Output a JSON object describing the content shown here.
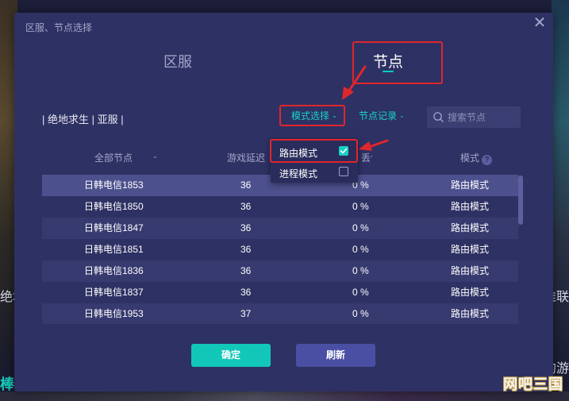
{
  "background": {
    "left_text": "绝地求",
    "right_text": "准联",
    "left_bottom_text": "棒",
    "right_bottom_text": "的游"
  },
  "dialog": {
    "title": "区服、节点选择",
    "close_symbol": "✕",
    "tabs": [
      {
        "label": "区服",
        "active": false
      },
      {
        "label": "节点",
        "active": true
      }
    ]
  },
  "toolbar": {
    "game_label": "| 绝地求生 | 亚服 |",
    "mode_select_label": "模式选择",
    "history_label": "节点记录",
    "search_placeholder": "搜索节点"
  },
  "table": {
    "headers": {
      "node": "全部节点",
      "latency": "游戏延迟",
      "loss": "丢包",
      "mode": "模式"
    },
    "rows": [
      {
        "node": "日韩电信1853",
        "latency": "36",
        "loss": "0 %",
        "mode": "路由模式"
      },
      {
        "node": "日韩电信1850",
        "latency": "36",
        "loss": "0 %",
        "mode": "路由模式"
      },
      {
        "node": "日韩电信1847",
        "latency": "36",
        "loss": "0 %",
        "mode": "路由模式"
      },
      {
        "node": "日韩电信1851",
        "latency": "36",
        "loss": "0 %",
        "mode": "路由模式"
      },
      {
        "node": "日韩电信1836",
        "latency": "36",
        "loss": "0 %",
        "mode": "路由模式"
      },
      {
        "node": "日韩电信1837",
        "latency": "36",
        "loss": "0 %",
        "mode": "路由模式"
      },
      {
        "node": "日韩电信1953",
        "latency": "37",
        "loss": "0 %",
        "mode": "路由模式"
      }
    ]
  },
  "dropdown": {
    "items": [
      {
        "label": "路由模式",
        "checked": true
      },
      {
        "label": "进程模式",
        "checked": false
      }
    ]
  },
  "buttons": {
    "confirm": "确定",
    "refresh": "刷新"
  },
  "watermark": "网吧三国",
  "colors": {
    "accent": "#18d4c8",
    "dialog_bg": "#2e3163",
    "annotation_red": "#e0262d",
    "refresh_bg": "#4b4fa3"
  }
}
